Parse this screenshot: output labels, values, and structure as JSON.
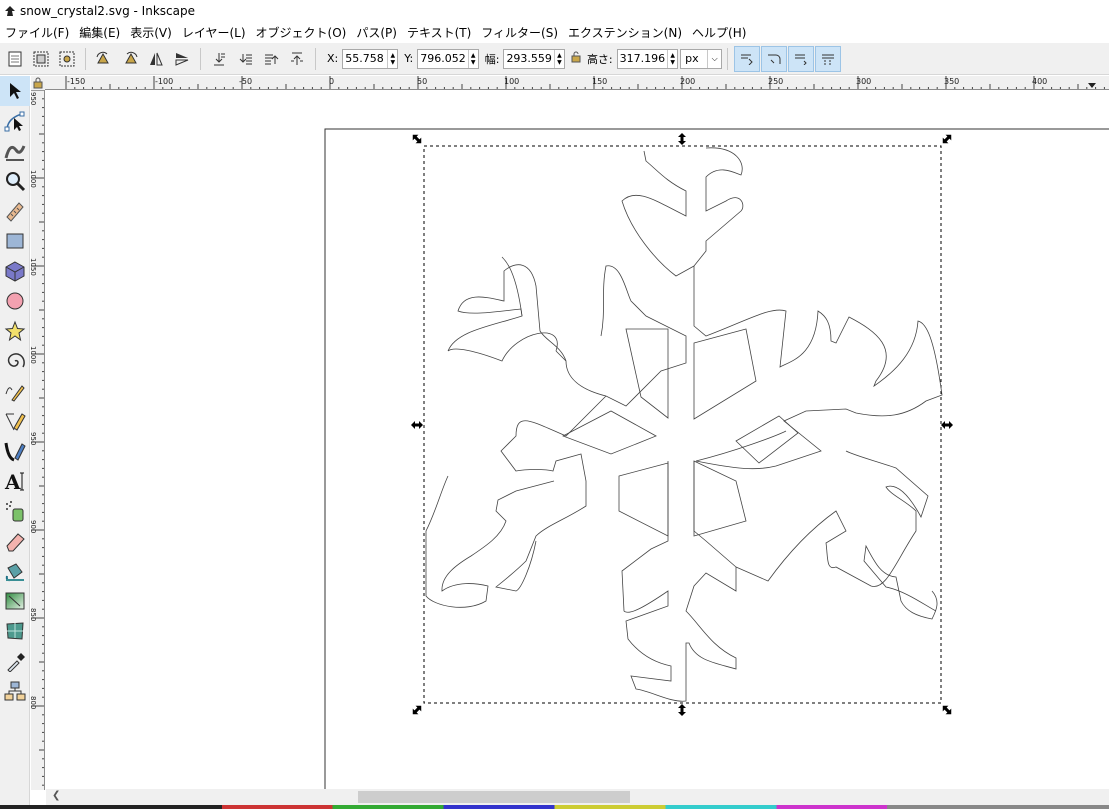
{
  "window": {
    "title": "snow_crystal2.svg - Inkscape"
  },
  "menu": [
    "ファイル(F)",
    "編集(E)",
    "表示(V)",
    "レイヤー(L)",
    "オブジェクト(O)",
    "パス(P)",
    "テキスト(T)",
    "フィルター(S)",
    "エクステンション(N)",
    "ヘルプ(H)"
  ],
  "toolbar": {
    "x_label": "X:",
    "x_value": "55.758",
    "y_label": "Y:",
    "y_value": "796.052",
    "w_label": "幅:",
    "w_value": "293.559",
    "h_label": "高さ:",
    "h_value": "317.196",
    "unit": "px"
  },
  "ruler_top_labels": [
    "-150",
    "-100",
    "-50",
    "0",
    "50",
    "100",
    "150",
    "200",
    "250",
    "300",
    "350",
    "400"
  ],
  "ruler_left_labels": [
    "950",
    "1000",
    "1050",
    "1000",
    "950",
    "900",
    "850",
    "800"
  ],
  "colors": {
    "accent": "#cde4f7",
    "chrome": "#f0f0f0",
    "selection": "#000000"
  },
  "tools": [
    "select-arrow-icon",
    "node-edit-icon",
    "tweak-icon",
    "zoom-icon",
    "measure-icon",
    "rectangle-icon",
    "3d-box-icon",
    "circle-icon",
    "star-icon",
    "spiral-icon",
    "pencil-icon",
    "pen-icon",
    "calligraphy-icon",
    "text-icon",
    "spray-icon",
    "eraser-icon",
    "paint-bucket-icon",
    "gradient-icon",
    "mesh-icon",
    "dropper-icon",
    "connector-icon"
  ]
}
